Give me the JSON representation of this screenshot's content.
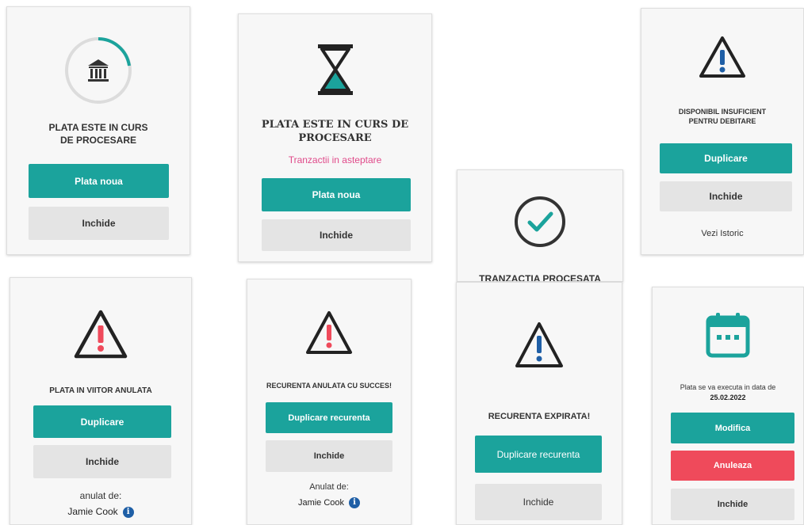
{
  "colors": {
    "teal": "#1ba39c",
    "red": "#ef4a5b",
    "gray": "#e4e4e4",
    "pink": "#e04a8a",
    "blue": "#1f5fa6"
  },
  "cards": {
    "c1": {
      "title_l1": "PLATA ESTE IN CURS",
      "title_l2": "DE PROCESARE",
      "btn_primary": "Plata noua",
      "btn_close": "Inchide",
      "icon": "bank-icon"
    },
    "c2": {
      "title_l1": "PLATA ESTE IN CURS DE",
      "title_l2": "PROCESARE",
      "subtitle": "Tranzactii in asteptare",
      "btn_primary": "Plata noua",
      "btn_close": "Inchide",
      "icon": "hourglass-icon"
    },
    "c3": {
      "title": "TRANZACTIA PROCESATA",
      "icon": "check-icon"
    },
    "c4": {
      "title_l1": "DISPONIBIL INSUFICIENT",
      "title_l2": "PENTRU DEBITARE",
      "btn_primary": "Duplicare",
      "btn_close": "Inchide",
      "link": "Vezi Istoric",
      "icon": "warning-icon"
    },
    "c5": {
      "title": "PLATA IN VIITOR ANULATA",
      "btn_primary": "Duplicare",
      "btn_close": "Inchide",
      "note": "anulat de:",
      "user": "Jamie Cook",
      "info": "i",
      "icon": "warning-icon"
    },
    "c6": {
      "title": "RECURENTA ANULATA CU SUCCES!",
      "btn_primary": "Duplicare recurenta",
      "btn_close": "Inchide",
      "note": "Anulat de:",
      "user": "Jamie Cook",
      "info": "i",
      "icon": "warning-icon"
    },
    "c7": {
      "title": "RECURENTA EXPIRATA!",
      "btn_primary": "Duplicare recurenta",
      "btn_close": "Inchide",
      "icon": "warning-icon"
    },
    "c8": {
      "text": "Plata se va executa in data de",
      "date": "25.02.2022",
      "btn_modify": "Modifica",
      "btn_cancel": "Anuleaza",
      "btn_close": "Inchide",
      "icon": "calendar-icon"
    }
  }
}
